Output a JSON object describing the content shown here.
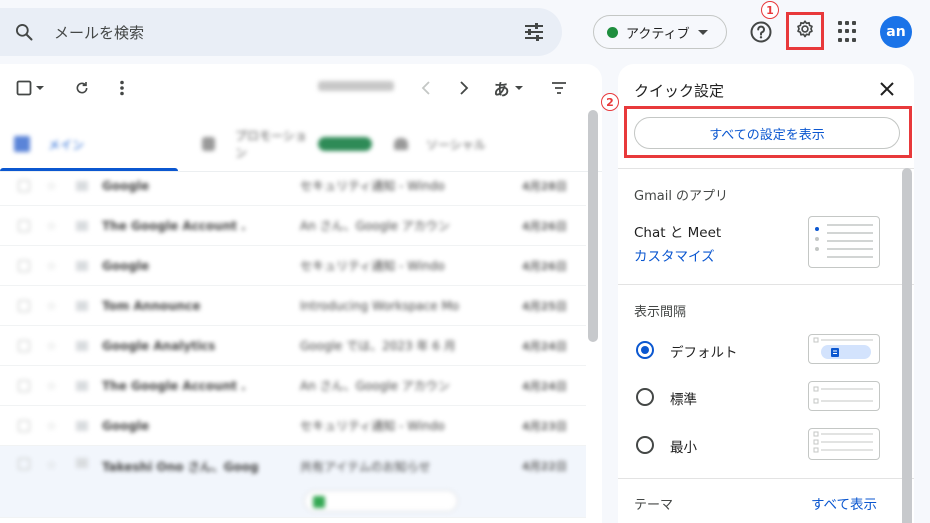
{
  "header": {
    "search_placeholder": "メールを検索",
    "status_label": "アクティブ",
    "avatar_initials": "an",
    "badge_1": "1",
    "badge_2": "2"
  },
  "quick_settings": {
    "title": "クイック設定",
    "all_settings_button": "すべての設定を表示",
    "section_apps": "Gmail のアプリ",
    "chat_meet": "Chat と Meet",
    "customize_link": "カスタマイズ",
    "section_density": "表示間隔",
    "density_options": [
      {
        "label": "デフォルト",
        "selected": true
      },
      {
        "label": "標準",
        "selected": false
      },
      {
        "label": "最小",
        "selected": false
      }
    ],
    "section_theme": "テーマ",
    "theme_show_all": "すべて表示"
  },
  "mail_toolbar": {
    "lang_label": "あ"
  },
  "mail_rows": [
    {
      "sender": "Google",
      "subject": "セキュリティ通知 - Windo",
      "date": "4月28日"
    },
    {
      "sender": "The Google Account .",
      "subject": "An さん、Google アカウン",
      "date": "4月26日"
    },
    {
      "sender": "Google",
      "subject": "セキュリティ通知 - Windo",
      "date": "4月26日"
    },
    {
      "sender": "Tom Announce",
      "subject": "Introducing Workspace Mo",
      "date": "4月25日"
    },
    {
      "sender": "Google Analytics",
      "subject": "Google では、2023 年 6 月",
      "date": "4月24日"
    },
    {
      "sender": "The Google Account .",
      "subject": "An さん、Google アカウン",
      "date": "4月24日"
    },
    {
      "sender": "Google",
      "subject": "セキュリティ通知 - Windo",
      "date": "4月23日"
    },
    {
      "sender": "Takeshi Ono さん、Goog",
      "subject": "共有アイテムのお知らせ",
      "date": "4月22日"
    }
  ],
  "tabs": [
    {
      "label": "メイン"
    },
    {
      "label": "プロモーション"
    },
    {
      "label": "ソーシャル"
    }
  ]
}
